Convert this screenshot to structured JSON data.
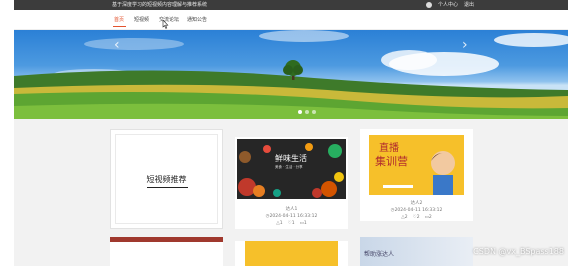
{
  "topbar": {
    "site_title": "基于深度学习的短视频内容理解与推荐系统",
    "links": [
      "个人中心",
      "退出"
    ]
  },
  "nav": {
    "items": [
      "首页",
      "短视频",
      "交流论坛",
      "通知公告"
    ],
    "active_index": 0
  },
  "banner": {
    "prev": "‹",
    "next": "›",
    "slide_count": 3,
    "active_slide": 1
  },
  "recommend": {
    "title": "短视频推荐"
  },
  "videos": [
    {
      "thumb_text": "鲜味生活",
      "thumb_sub": "美食 · 生活 · 分享",
      "author": "达人1",
      "time": "2024-04-11 16:33:12",
      "likes": "1",
      "favorites": "1",
      "comments": "1"
    },
    {
      "thumb_text_line1": "直播",
      "thumb_text_line2": "集训营",
      "author": "达人2",
      "time": "2024-04-11 16:33:12",
      "likes": "2",
      "favorites": "2",
      "comments": "2"
    }
  ],
  "row2_thumb_text": "帮助涨达人",
  "watermark": "CSDN @vx_BSpass188",
  "colors": {
    "accent": "#e3542f",
    "topbar": "#3c3c3c",
    "sky": "#2b80d6",
    "grass": "#4a8f2e",
    "live_yellow": "#f6c02a"
  }
}
